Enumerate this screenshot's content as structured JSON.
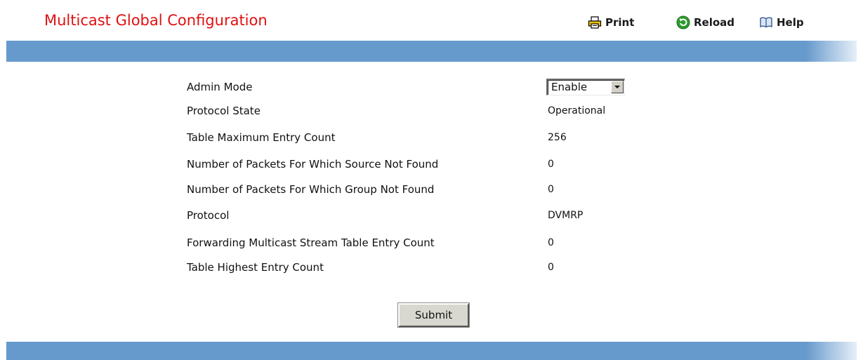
{
  "page": {
    "title": "Multicast Global Configuration"
  },
  "toolbar": {
    "print_label": "Print",
    "reload_label": "Reload",
    "help_label": "Help"
  },
  "form": {
    "rows": [
      {
        "label": "Admin Mode",
        "value": "Enable"
      },
      {
        "label": "Protocol State",
        "value": "Operational"
      },
      {
        "label": "Table Maximum Entry Count",
        "value": "256"
      },
      {
        "label": "Number of Packets For Which Source Not Found",
        "value": "0"
      },
      {
        "label": "Number of Packets For Which Group Not Found",
        "value": "0"
      },
      {
        "label": "Protocol",
        "value": "DVMRP"
      },
      {
        "label": "Forwarding Multicast Stream Table Entry Count",
        "value": "0"
      },
      {
        "label": "Table Highest Entry Count",
        "value": "0"
      }
    ],
    "submit_label": "Submit"
  },
  "colors": {
    "title": "#e01010",
    "bar": "#6699cc"
  },
  "icons": {
    "print": "printer-icon",
    "reload": "reload-icon",
    "help": "help-book-icon",
    "dropdown": "chevron-down-icon"
  }
}
